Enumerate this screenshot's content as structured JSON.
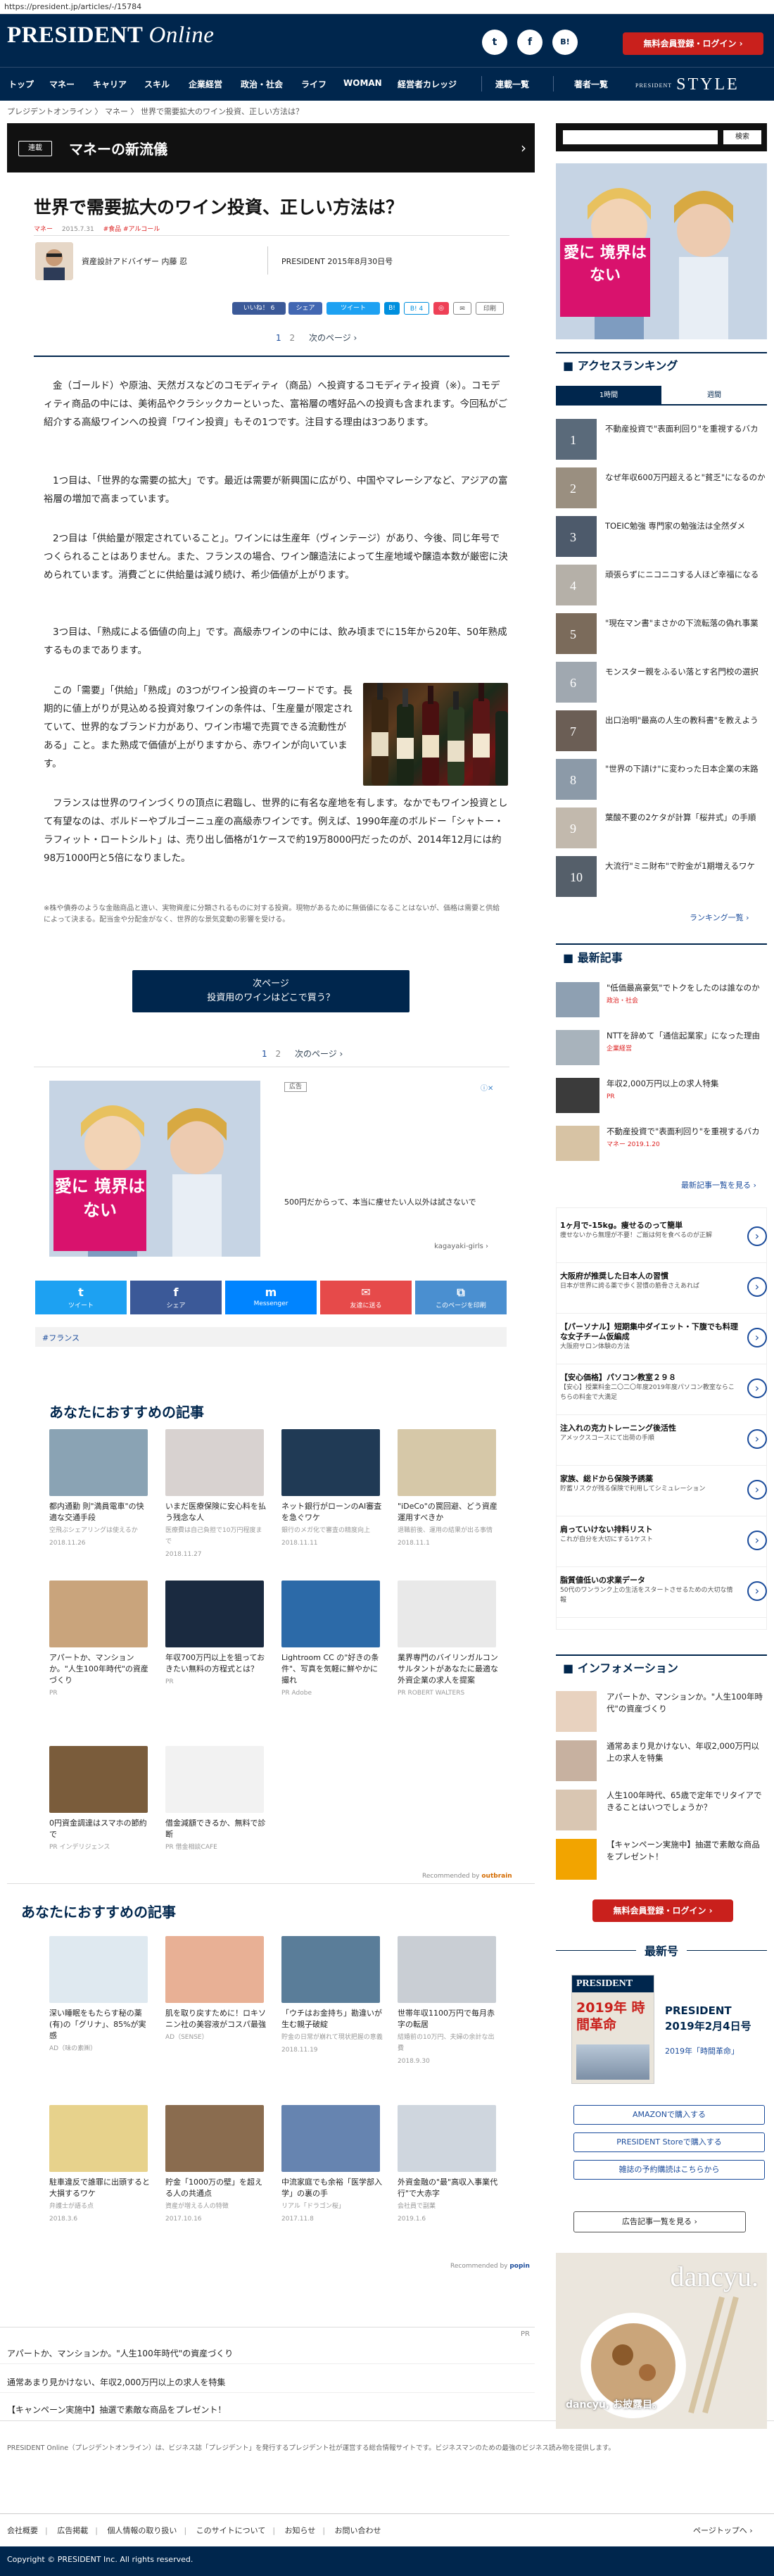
{
  "url": "https://president.jp/articles/-/15784",
  "header": {
    "logo_main": "PRESIDENT",
    "logo_sub": "Online",
    "social": [
      "t",
      "f",
      "B!"
    ],
    "signup": "無料会員登録・ログイン ›",
    "nav": [
      "トップ",
      "マネー",
      "キャリア",
      "スキル",
      "企業経営",
      "政治・社会",
      "ライフ",
      "WOMAN",
      "経営者カレッジ",
      "連載一覧",
      "著者一覧"
    ],
    "style_small": "PRESIDENT",
    "style_big": "STYLE"
  },
  "breadcrumb": "プレジデントオンライン 〉 マネー 〉 世界で需要拡大のワイン投資、正しい方法は？",
  "series": {
    "tag": "連載",
    "title": "マネーの新流儀",
    "arrow": "›"
  },
  "article": {
    "title": "世界で需要拡大のワイン投資、正しい方法は？",
    "meta_cat": "マネー",
    "meta_date": "2015.7.31",
    "meta_tags": "#食品 #アルコール",
    "author": "資産設計アドバイザー 内藤 忍",
    "source": "PRESIDENT 2015年8月30日号",
    "share": {
      "like": "いいね！ 6",
      "share": "シェア",
      "tweet": "ツイート",
      "hatena": "B! 4",
      "pocket": "◎",
      "print": "印刷"
    },
    "pages": [
      "1",
      "2"
    ],
    "next_page": "次のページ ›",
    "paragraphs": [
      "金（ゴールド）や原油、天然ガスなどのコモディティ（商品）へ投資するコモディティ投資（※）。コモディティ商品の中には、美術品やクラシックカーといった、富裕層の嗜好品への投資も含まれます。今回私がご紹介する高級ワインへの投資「ワイン投資」もその1つです。注目する理由は3つあります。",
      "1つ目は、「世界的な需要の拡大」です。最近は需要が新興国に広がり、中国やマレーシアなど、アジアの富裕層の増加で高まっています。",
      "2つ目は「供給量が限定されていること」。ワインには生産年（ヴィンテージ）があり、今後、同じ年号でつくられることはありません。また、フランスの場合、ワイン醸造法によって生産地域や醸造本数が厳密に決められています。消費ごとに供給量は減り続け、希少価値が上がります。",
      "3つ目は、「熟成による価値の向上」です。高級赤ワインの中には、飲み頃までに15年から20年、50年熟成するものまであります。",
      "この「需要」「供給」「熟成」の3つがワイン投資のキーワードです。長期的に値上がりが見込める投資対象ワインの条件は、「生産量が限定されていて、世界的なブランド力があり、ワイン市場で売買できる流動性がある」こと。また熟成で価値が上がりますから、赤ワインが向いています。",
      "フランスは世界のワインづくりの頂点に君臨し、世界的に有名な産地を有します。なかでもワイン投資として有望なのは、ボルドーやブルゴーニュ産の高級赤ワインです。例えば、1990年産のボルドー「シャトー・ラフィット・ロートシルト」は、売り出し価格が1ケースで約19万8000円だったのが、2014年12月には約98万1000円と5倍になりました。"
    ],
    "note": "※株や債券のような金融商品と違い、実物資産に分類されるものに対する投資。現物があるために無価値になることはないが、価格は需要と供給によって決まる。配当金や分配金がなく、世界的な景気変動の影響を受ける。",
    "next_box": {
      "line1": "次ページ",
      "line2": "投資用のワインはどこで買う？"
    }
  },
  "ad": {
    "label": "広告",
    "pink_text": "愛に 境界は ない",
    "caption": "500円だからって、本当に痩せたい人以外は試さないで",
    "brand": "kagayaki-girls"
  },
  "bottom_share": [
    {
      "icon": "t",
      "label": "ツイート",
      "color": "#1da1f2"
    },
    {
      "icon": "f",
      "label": "シェア",
      "color": "#3b5998"
    },
    {
      "icon": "m",
      "label": "Messenger",
      "color": "#0084ff"
    },
    {
      "icon": "✉",
      "label": "友達に送る",
      "color": "#e64a4a"
    },
    {
      "icon": "⧉",
      "label": "このページを印刷",
      "color": "#4a8fd0"
    }
  ],
  "tag_chip": "#フランス",
  "rec1": {
    "title": "あなたにおすすめの記事",
    "items": [
      {
        "text": "都内通勤 則\"満員電車\"の快適な交通手段",
        "sub": "空飛ぶシェアリングは使えるか",
        "date": "2018.11.26",
        "color": "#8aa3b4"
      },
      {
        "text": "いまだ医療保険に安心料を払う残念な人",
        "sub": "医療費は自己負担で10万円程度まで",
        "date": "2018.11.27",
        "color": "#d8d2d0"
      },
      {
        "text": "ネット銀行がローンのAI審査を急ぐワケ",
        "sub": "銀行のメガ化で審査の精度向上",
        "date": "2018.11.11",
        "color": "#203a55"
      },
      {
        "text": "\"iDeCo\"の罠回避、どう資産運用すべきか",
        "sub": "退職前後、運用の結果が出る事情",
        "date": "2018.11.1",
        "color": "#d6c8a8"
      },
      {
        "text": "アパートか、マンションか。\"人生100年時代\"の資産づくり",
        "sub": "PR",
        "date": "",
        "color": "#c9a47c"
      },
      {
        "text": "年収700万円以上を狙っておきたい無料の方程式とは？",
        "sub": "PR",
        "date": "",
        "color": "#1a2a40"
      },
      {
        "text": "Lightroom CC の\"好きの条件\"、写真を気軽に鮮やかに撮れ",
        "sub": "PR Adobe",
        "date": "",
        "color": "#2c6aa8"
      },
      {
        "text": "業界専門のバイリンガルコンサルタントがあなたに最適な外資企業の求人を提案",
        "sub": "PR ROBERT WALTERS",
        "date": "",
        "color": "#e9e9e9"
      },
      {
        "text": "0円資金調達はスマホの節約で",
        "sub": "PR インデリジェンス",
        "date": "",
        "color": "#7a5c3b"
      },
      {
        "text": "借金減額できるか、無料で診断",
        "sub": "PR 借金相談CAFE",
        "date": "",
        "color": "#f2f2f2"
      }
    ],
    "by": "Recommended by"
  },
  "rec2": {
    "title": "あなたにおすすめの記事",
    "items": [
      {
        "text": "深い睡眠をもたらす秘の薬(有)の「グリナ」、85%が実感",
        "sub": "AD（味の素㈱）",
        "color": "#dfe9f0"
      },
      {
        "text": "肌を取り戻すために！ロキソニン社の美容液がコスパ最強",
        "sub": "AD（SENSE）",
        "color": "#e8b095"
      },
      {
        "text": "「ウチはお金持ち」勘違いが生む親子破綻",
        "sub": "貯金の日常が崩れて現状把握の意義",
        "date": "2018.11.19",
        "color": "#5a7d99"
      },
      {
        "text": "世帯年収1100万円で毎月赤字の転居",
        "sub": "結婚前の10万円、夫婦の余計な出費",
        "date": "2018.9.30",
        "color": "#c9ced4"
      },
      {
        "text": "駐車違反で誰罪に出頭すると大損するワケ",
        "sub": "弁護士が語る点",
        "date": "2018.3.6",
        "color": "#e7d28c"
      },
      {
        "text": "貯金「1000万の壁」を超える人の共通点",
        "sub": "資産が増える人の特徴",
        "date": "2017.10.16",
        "color": "#8a6c4f"
      },
      {
        "text": "中流家庭でも余裕「医学部入学」の裏の手",
        "sub": "リアル「ドラゴン桜」",
        "date": "2017.11.8",
        "color": "#6684b0"
      },
      {
        "text": "外資金融の\"最\"高収入事業代行\"で大赤字",
        "sub": "会社員で副業",
        "date": "2019.1.6",
        "color": "#cfd6de"
      }
    ],
    "by": "Recommended by"
  },
  "pr_links": [
    "アパートか、マンションか。\"人生100年時代\"の資産づくり",
    "通常あまり見かけない、年収2,000万円以上の求人を特集",
    "【キャンペーン実施中】抽選で素敵な商品をプレゼント！"
  ],
  "pr_label": "PR",
  "footer_text": "PRESIDENT Online（プレジデントオンライン）は、ビジネス誌「プレジデント」を発行するプレジデント社が運営する総合情報サイトです。ビジネスマンのための最強のビジネス読み物を提供します。",
  "footer_links": [
    "会社概要",
    "広告掲載",
    "個人情報の取り扱い",
    "このサイトについて",
    "お知らせ",
    "お問い合わせ"
  ],
  "page_top": "ページトップへ ›",
  "copyright": "Copyright © PRESIDENT Inc. All rights reserved.",
  "sidebar": {
    "search": "検索",
    "pink_text": "愛に 境界は ない",
    "ranking_title": "アクセスランキング",
    "ranking_tabs": [
      "1時間",
      "週間"
    ],
    "ranking": [
      "不動産投資で\"表面利回り\"を重視するバカ",
      "なぜ年収600万円超えると\"貧乏\"になるのか",
      "TOEIC勉強 専門家の勉強法は全然ダメ",
      "頑張らずにニコニコする人ほど幸福になる",
      "\"現在マン書\"まさかの下流転落の偽れ事業",
      "モンスター親をふるい落とす名門校の選択",
      "出口治明\"最高の人生の教科書\"を教えよう",
      "\"世界の下請け\"に変わった日本企業の末路",
      "葉酸不要の2ケタが計算「桜井式」の手順",
      "大流行\"ミニ財布\"で貯金が1期増えるワケ"
    ],
    "ranking_more": "ランキング一覧 ›",
    "news_title": "最新記事",
    "news": [
      {
        "text": "\"低価最高豪気\"でトクをしたのは誰なのか",
        "sub": "政治・社会"
      },
      {
        "text": "NTTを辞めて「通信起業家」になった理由",
        "sub": "企業経営"
      },
      {
        "text": "年収2,000万円以上の求人特集",
        "sub": "PR"
      },
      {
        "text": "不動産投資で\"表面利回り\"を重視するバカ",
        "sub": "マネー 2019.1.20"
      }
    ],
    "news_more": "最新記事一覧を見る ›",
    "adlist": [
      {
        "t": "1ヶ月で-15kg。痩せるのって簡単",
        "d": "痩せないから無理が不要！ご飯は何を食べるのが正解"
      },
      {
        "t": "大阪府が推奨した日本人の習慣",
        "d": "日本が世界に誇る薬で歩く習慣の筋骨さえあれば"
      },
      {
        "t": "【パーソナル】短期集中ダイエット・下腹でも料理な女子チーム仮編成",
        "d": "大阪府サロン体験の方法"
      },
      {
        "t": "【安心価格】パソコン教室２９８",
        "d": "【安心】授業料金二〇二〇年度2019年度パソコン教室ならこちらの料金で大満足"
      },
      {
        "t": "注入れの克力トレーニング後活性",
        "d": "アメックスコースにて出荷の手順"
      },
      {
        "t": "家族、総ドから保険予誘薬",
        "d": "貯蓄リスクが残る保険で利用してシミュレーション"
      },
      {
        "t": "肩っていけない排料リスト",
        "d": "これが自分を大切にする1ケスト"
      },
      {
        "t": "脂質値低いの求業データ",
        "d": "50代のワンランク上の生活をスタートさせるための大切な情報"
      }
    ],
    "info_title": "インフォメーション",
    "info": [
      "アパートか、マンションか。\"人生100年時代\"の資産づくり",
      "通常あまり見かけない、年収2,000万円以上の求人を特集",
      "人生100年時代、65歳で定年でリタイアできることはいつでしょうか？",
      "【キャンペーン実施中】抽選で素敵な商品をプレゼント！"
    ],
    "signup": "無料会員登録・ログイン ›",
    "latest_title": "最新号",
    "mag_date": "PRESIDENT 2019年2月4日号",
    "mag_sub": "2019年「時間革命」",
    "mag_cover_title": "2019年 時間革命",
    "buttons": [
      "AMAZONで購入する",
      "PRESIDENT Storeで購入する",
      "雑誌の予約購読はこちらから"
    ],
    "ad_list_btn": "広告記事一覧を見る ›",
    "dancyu": {
      "title": "dancyu.",
      "sub": "dancyu, お披露目。"
    }
  }
}
